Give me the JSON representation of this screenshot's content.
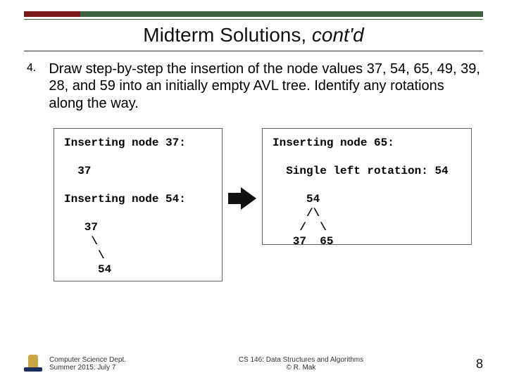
{
  "title_main": "Midterm Solutions, ",
  "title_italic": "cont'd",
  "question_number": "4.",
  "question_text": "Draw step-by-step the insertion of the node values 37, 54, 65, 49, 39, 28, and 59 into an initially empty AVL tree. Identify any rotations along the way.",
  "box1": "Inserting node 37:\n\n  37\n\nInserting node 54:\n\n   37\n    \\\n     \\\n     54",
  "box2": "Inserting node 65:\n\n  Single left rotation: 54\n\n     54\n     /\\\n    /  \\\n   37  65",
  "footer_left_line1": "Computer Science Dept.",
  "footer_left_line2": "Summer 2015: July 7",
  "footer_center_line1": "CS 146: Data Structures and Algorithms",
  "footer_center_line2": "© R. Mak",
  "page_number": "8",
  "logo_name": "San Jose State University"
}
